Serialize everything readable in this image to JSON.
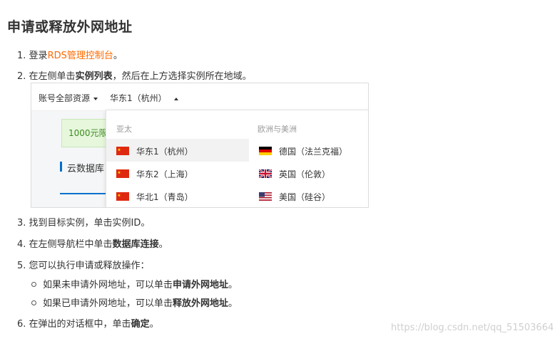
{
  "title": "申请或释放外网地址",
  "steps": {
    "s1": {
      "num": "1.",
      "pre": "登录",
      "link": "RDS管理控制台",
      "post": "。"
    },
    "s2": {
      "num": "2.",
      "pre": "在左侧单击",
      "bold": "实例列表",
      "post": "，然后在上方选择实例所在地域。"
    },
    "s3": {
      "num": "3.",
      "text": "找到目标实例，单击实例ID。"
    },
    "s4": {
      "num": "4.",
      "pre": "在左侧导航栏中单击",
      "bold": "数据库连接",
      "post": "。"
    },
    "s5": {
      "num": "5.",
      "text": "您可以执行申请或释放操作："
    },
    "s6": {
      "num": "6.",
      "pre": "在弹出的对话框中，单击",
      "bold": "确定",
      "post": "。"
    }
  },
  "bullets": [
    {
      "pre": "如果未申请外网地址，可以单击",
      "bold": "申请外网地址",
      "post": "。"
    },
    {
      "pre": "如果已申请外网地址，可以单击",
      "bold": "释放外网地址",
      "post": "。"
    }
  ],
  "screenshot": {
    "account_label": "账号全部资源",
    "region_label": "华东1（杭州）",
    "promo_text": "1000元限",
    "section_text": "云数据库",
    "columns": [
      {
        "heading": "亚太",
        "items": [
          {
            "label": "华东1（杭州）",
            "flag": "china-flag",
            "selected": true
          },
          {
            "label": "华东2（上海）",
            "flag": "china-flag"
          },
          {
            "label": "华北1（青岛）",
            "flag": "china-flag"
          }
        ]
      },
      {
        "heading": "欧洲与美洲",
        "items": [
          {
            "label": "德国（法兰克福）",
            "flag": "germany-flag"
          },
          {
            "label": "英国（伦敦）",
            "flag": "uk-flag"
          },
          {
            "label": "美国（硅谷）",
            "flag": "usa-flag"
          }
        ]
      }
    ]
  },
  "watermark": "https://blog.csdn.net/qq_51503664",
  "colors": {
    "link": "#ff6a00",
    "accent_blue": "#0070cc",
    "promo_green": "#3d8b1f"
  }
}
